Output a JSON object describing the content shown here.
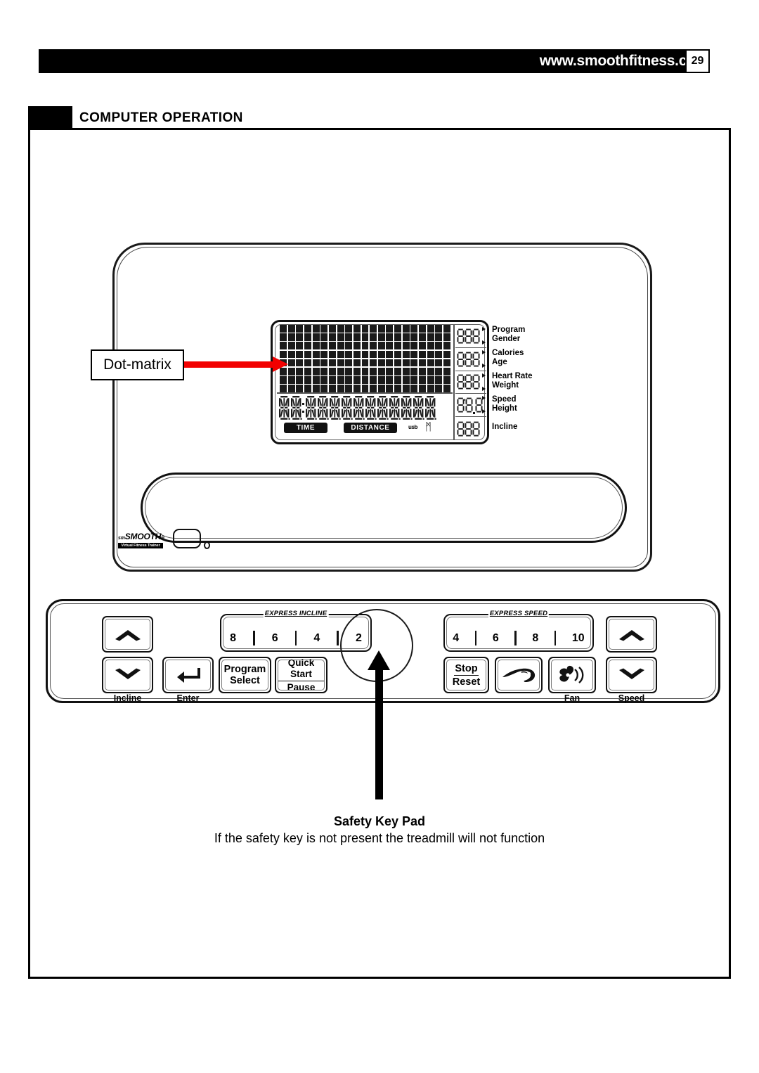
{
  "header": {
    "url": "www.smoothfitness.com",
    "page_number": "29"
  },
  "section": {
    "title": "COMPUTER OPERATION"
  },
  "callout": {
    "label": "Dot-matrix",
    "arrow_color": "#f20000"
  },
  "console": {
    "logo": {
      "prefix": "sm",
      "name": "SMOOTH",
      "registered": "®",
      "tagline": "Virtual Fitness Trainer"
    },
    "lcd": {
      "dot_matrix": {
        "columns": 21,
        "rows": 8
      },
      "alphanumeric_chars": 13,
      "tags": {
        "time": "TIME",
        "distance": "DISTANCE",
        "usb": "usb",
        "bluetooth": "ᛗ"
      },
      "readout_rows": [
        {
          "digits": 3,
          "labels": [
            "Program",
            "Gender"
          ],
          "arrows": 2
        },
        {
          "digits": 3,
          "labels": [
            "Calories",
            "Age"
          ],
          "arrows": 2
        },
        {
          "digits": 3,
          "labels": [
            "Heart Rate",
            "Weight"
          ],
          "arrows": 2
        },
        {
          "digits": 3,
          "labels": [
            "Speed",
            "Height"
          ],
          "arrows": 2
        },
        {
          "digits": 3,
          "labels": [
            "Incline"
          ],
          "arrows": 0
        }
      ]
    }
  },
  "keypad": {
    "incline": {
      "up_label": "chevron-up",
      "down_label": "chevron-down",
      "group_label": "Incline"
    },
    "enter": {
      "icon": "enter-arrow",
      "group_label": "Enter"
    },
    "express_incline": {
      "title": "EXPRESS INCLINE",
      "values": [
        "8",
        "6",
        "4",
        "2"
      ]
    },
    "express_speed": {
      "title": "EXPRESS SPEED",
      "values": [
        "4",
        "6",
        "8",
        "10"
      ]
    },
    "program_select": {
      "line1": "Program",
      "line2": "Select"
    },
    "quick_start": {
      "line1": "Quick Start",
      "line2": "Pause"
    },
    "stop_reset": {
      "line1": "Stop",
      "line2": "Reset"
    },
    "runner": {
      "icon": "runner-icon"
    },
    "fan": {
      "icon": "fan-icon",
      "group_label": "Fan"
    },
    "speed": {
      "up_label": "chevron-up",
      "down_label": "chevron-down",
      "group_label": "Speed"
    }
  },
  "caption": {
    "title": "Safety Key Pad",
    "subtitle": "If the safety key is not present the treadmill will not function"
  }
}
